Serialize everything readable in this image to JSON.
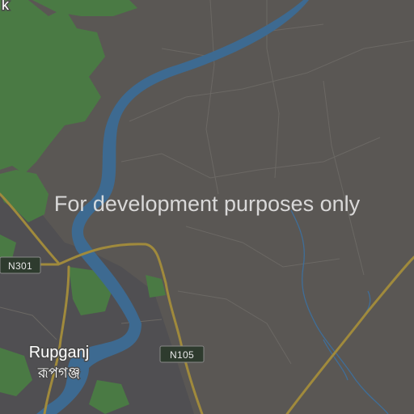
{
  "map": {
    "watermark": "For development purposes only",
    "edge_label_top_left": "k",
    "places": {
      "rupganj_latin": "Rupganj",
      "rupganj_bengali": "রূপগঞ্জ"
    },
    "roads": {
      "n301": "N301",
      "n105": "N105"
    },
    "colors": {
      "land": "#5a5754",
      "urban": "#4f4f52",
      "river": "#3d6a91",
      "park": "#4a7a44",
      "road": "#a08a3c",
      "minor_road": "#6a6763",
      "stream": "#3f6e99",
      "shield_bg": "#2e3b2e"
    }
  }
}
